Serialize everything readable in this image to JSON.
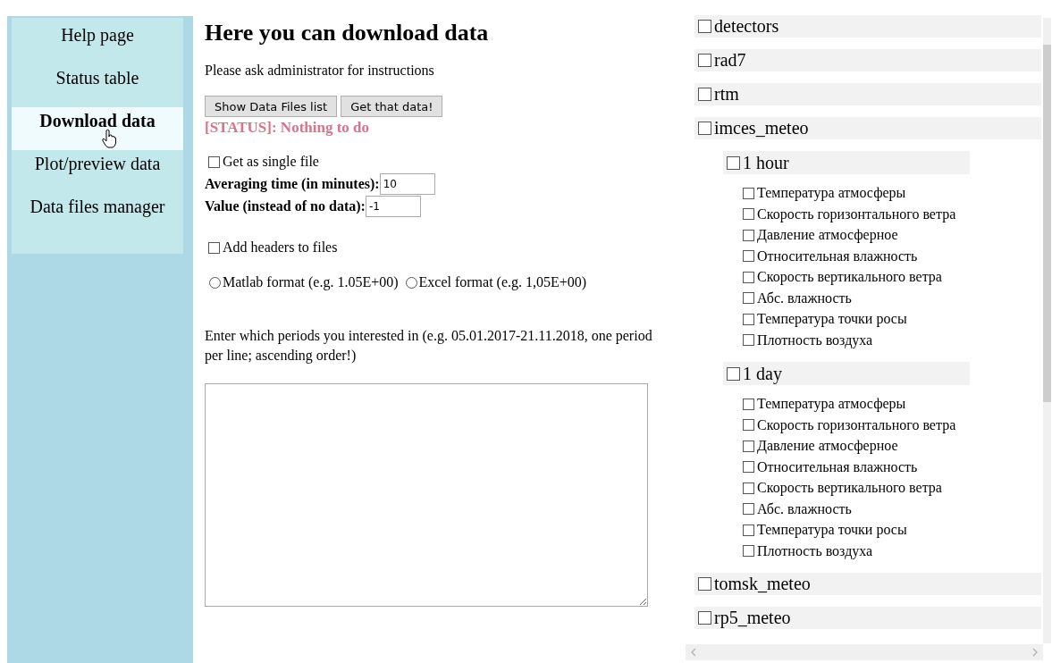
{
  "sidebar": {
    "items": [
      {
        "label": "Help page",
        "selected": false
      },
      {
        "label": "Status table",
        "selected": false
      },
      {
        "label": "Download data",
        "selected": true
      },
      {
        "label": "Plot/preview data",
        "selected": false
      },
      {
        "label": "Data files manager",
        "selected": false
      }
    ]
  },
  "main": {
    "title": "Here you can download data",
    "intro": "Please ask administrator for instructions",
    "buttons": [
      "Show Data Files list",
      "Get that data!"
    ],
    "status": "[STATUS]: Nothing to do",
    "single_file": {
      "label": "Get as single file",
      "checked": false
    },
    "averaging": {
      "label": "Averaging time (in minutes):",
      "value": "10"
    },
    "no_data_value": {
      "label": "Value (instead of no data):",
      "value": "-1"
    },
    "headers": {
      "label": "Add headers to files",
      "checked": false
    },
    "formats": [
      {
        "label": "Matlab format (e.g. 1.05E+00)",
        "selected": false
      },
      {
        "label": "Excel format (e.g. 1,05E+00)",
        "selected": false
      }
    ],
    "periods_prompt": "Enter which periods you interested in (e.g. 05.01.2017-21.11.2018, one period per line; ascending order!)"
  },
  "tree": [
    {
      "label": "detectors",
      "checked": false
    },
    {
      "label": "rad7",
      "checked": false
    },
    {
      "label": "rtm",
      "checked": false
    },
    {
      "label": "imces_meteo",
      "checked": false,
      "children": [
        {
          "label": "1 hour",
          "checked": false,
          "children": [
            {
              "label": "Температура атмосферы",
              "checked": false
            },
            {
              "label": "Скорость горизонтального ветра",
              "checked": false
            },
            {
              "label": "Давление атмосферное",
              "checked": false
            },
            {
              "label": "Относительная влажность",
              "checked": false
            },
            {
              "label": "Скорость вертикального ветра",
              "checked": false
            },
            {
              "label": "Абс. влажность",
              "checked": false
            },
            {
              "label": "Температура точки росы",
              "checked": false
            },
            {
              "label": "Плотность воздуха",
              "checked": false
            }
          ]
        },
        {
          "label": "1 day",
          "checked": false,
          "children": [
            {
              "label": "Температура атмосферы",
              "checked": false
            },
            {
              "label": "Скорость горизонтального ветра",
              "checked": false
            },
            {
              "label": "Давление атмосферное",
              "checked": false
            },
            {
              "label": "Относительная влажность",
              "checked": false
            },
            {
              "label": "Скорость вертикального ветра",
              "checked": false
            },
            {
              "label": "Абс. влажность",
              "checked": false
            },
            {
              "label": "Температура точки росы",
              "checked": false
            },
            {
              "label": "Плотность воздуха",
              "checked": false
            }
          ]
        }
      ]
    },
    {
      "label": "tomsk_meteo",
      "checked": false
    },
    {
      "label": "rp5_meteo",
      "checked": false
    }
  ]
}
